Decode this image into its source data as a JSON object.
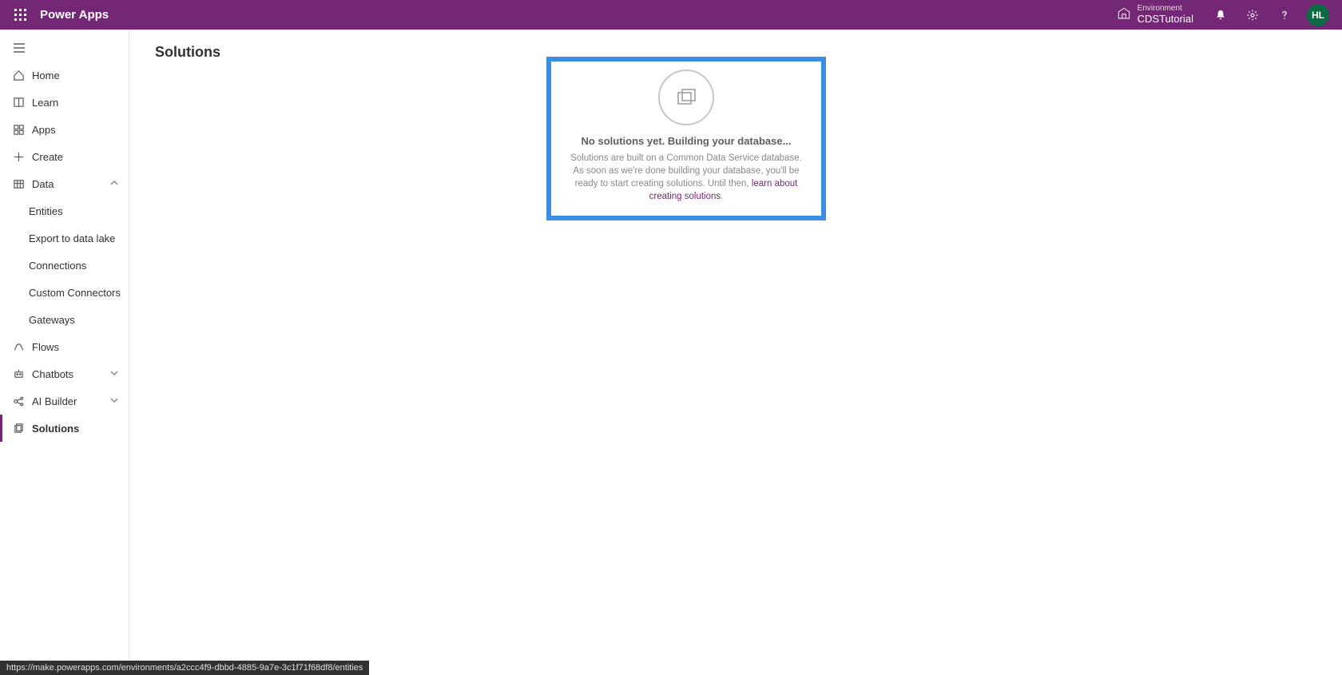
{
  "header": {
    "brand": "Power Apps",
    "environment_label": "Environment",
    "environment_name": "CDSTutorial",
    "avatar_initials": "HL"
  },
  "sidebar": {
    "home": "Home",
    "learn": "Learn",
    "apps": "Apps",
    "create": "Create",
    "data": "Data",
    "data_children": {
      "entities": "Entities",
      "export_to_data_lake": "Export to data lake",
      "connections": "Connections",
      "custom_connectors": "Custom Connectors",
      "gateways": "Gateways"
    },
    "flows": "Flows",
    "chatbots": "Chatbots",
    "ai_builder": "AI Builder",
    "solutions": "Solutions"
  },
  "main": {
    "title": "Solutions",
    "empty_title": "No solutions yet. Building your database...",
    "empty_desc_part1": "Solutions are built on a Common Data Service database. As soon as we're done building your database, you'll be ready to start creating solutions. Until then, ",
    "empty_link": "learn about creating solutions",
    "empty_desc_part2": "."
  },
  "statusbar": {
    "text": "https://make.powerapps.com/environments/a2ccc4f9-dbbd-4885-9a7e-3c1f71f68df8/entities"
  }
}
